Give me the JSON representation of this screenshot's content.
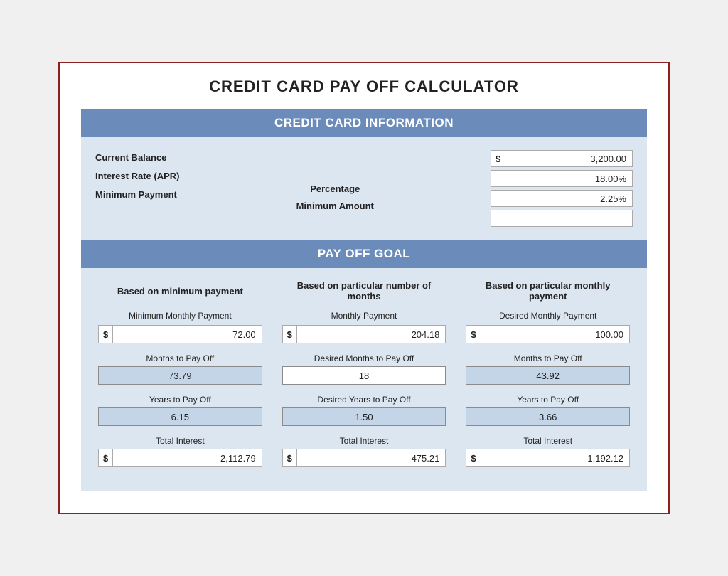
{
  "title": "CREDIT CARD PAY OFF CALCULATOR",
  "sections": {
    "card_info": {
      "header": "CREDIT CARD INFORMATION",
      "labels": {
        "balance": "Current Balance",
        "interest": "Interest Rate (APR)",
        "minimum_payment": "Minimum Payment",
        "percentage": "Percentage",
        "minimum_amount": "Minimum Amount"
      },
      "values": {
        "balance": "3,200.00",
        "interest": "18.00%",
        "percentage": "2.25%",
        "minimum_amount": ""
      }
    },
    "payoff_goal": {
      "header": "PAY OFF GOAL",
      "columns": [
        {
          "header": "Based on minimum payment",
          "sub_label": "Minimum Monthly Payment",
          "payment_dollar": "$",
          "payment_value": "72.00",
          "months_label": "Months to Pay Off",
          "months_value": "73.79",
          "years_label": "Years to Pay Off",
          "years_value": "6.15",
          "interest_label": "Total Interest",
          "interest_dollar": "$",
          "interest_value": "2,112.79"
        },
        {
          "header": "Based on particular number of months",
          "sub_label": "Monthly Payment",
          "payment_dollar": "$",
          "payment_value": "204.18",
          "months_label": "Desired Months to Pay Off",
          "months_value": "18",
          "years_label": "Desired Years to Pay Off",
          "years_value": "1.50",
          "interest_label": "Total Interest",
          "interest_dollar": "$",
          "interest_value": "475.21"
        },
        {
          "header": "Based on particular monthly payment",
          "sub_label": "Desired Monthly Payment",
          "payment_dollar": "$",
          "payment_value": "100.00",
          "months_label": "Months to Pay Off",
          "months_value": "43.92",
          "years_label": "Years to Pay Off",
          "years_value": "3.66",
          "interest_label": "Total Interest",
          "interest_dollar": "$",
          "interest_value": "1,192.12"
        }
      ]
    }
  }
}
